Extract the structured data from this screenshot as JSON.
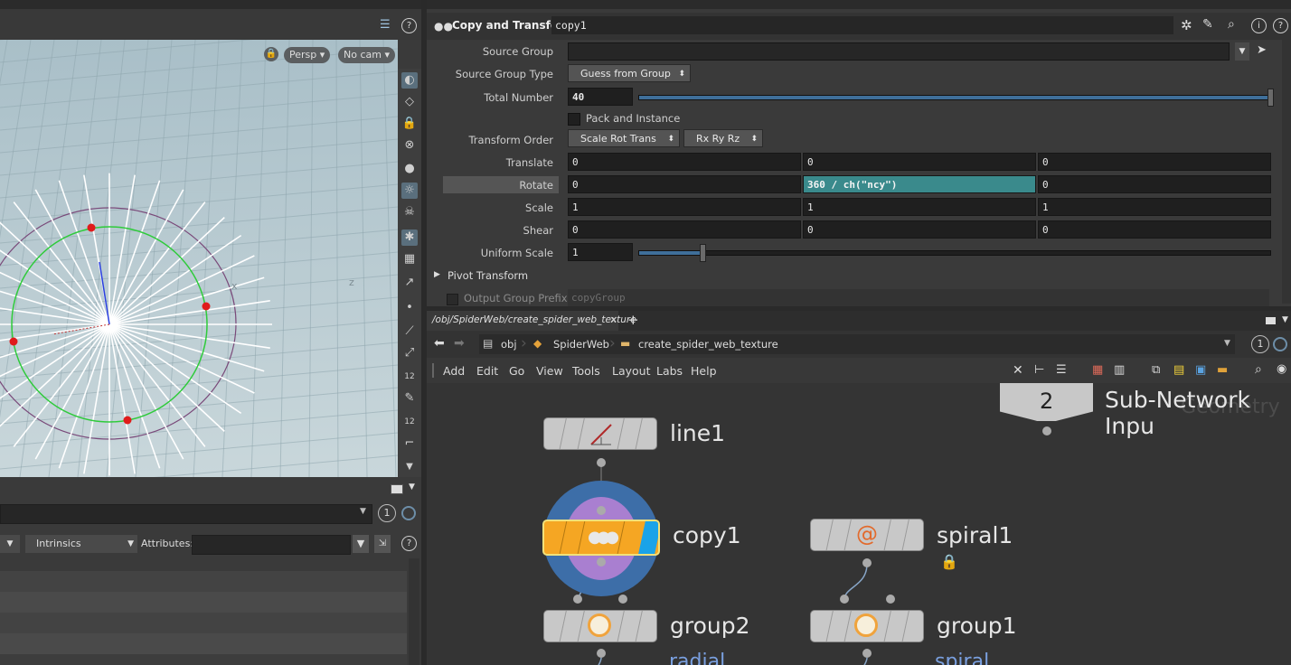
{
  "viewport": {
    "persp_label": "Persp",
    "cam_label": "No cam",
    "axis_x_label": "x",
    "axis_z_label": "z"
  },
  "lower_left": {
    "instance_value": "1",
    "intrinsics_label": "Intrinsics",
    "attributes_label": "Attributes:"
  },
  "params": {
    "node_type": "Copy and Transform",
    "node_name": "copy1",
    "source_group_label": "Source Group",
    "source_group_value": "",
    "source_group_type_label": "Source Group Type",
    "source_group_type_value": "Guess from Group",
    "total_number_label": "Total Number",
    "total_number_value": "40",
    "total_number_fraction": 1.0,
    "pack_label": "Pack and Instance",
    "transform_order_label": "Transform Order",
    "transform_order_value": "Scale Rot Trans",
    "rotate_order_value": "Rx Ry Rz",
    "translate_label": "Translate",
    "translate": [
      "0",
      "0",
      "0"
    ],
    "rotate_label": "Rotate",
    "rotate": [
      "0",
      "360 / ch(\"ncy\")",
      "0"
    ],
    "scale_label": "Scale",
    "scale": [
      "1",
      "1",
      "1"
    ],
    "shear_label": "Shear",
    "shear": [
      "0",
      "0",
      "0"
    ],
    "uniform_scale_label": "Uniform Scale",
    "uniform_scale_value": "1",
    "uniform_scale_fraction": 0.1,
    "pivot_label": "Pivot Transform",
    "output_group_prefix_label": "Output Group Prefix",
    "output_group_prefix_value": "copyGroup"
  },
  "network": {
    "tab_path": "/obj/SpiderWeb/create_spider_web_texture",
    "tab_close": "×",
    "tab_add": "+",
    "breadcrumb": [
      "obj",
      "SpiderWeb",
      "create_spider_web_texture"
    ],
    "instance_value": "1",
    "menu": [
      "Add",
      "Edit",
      "Go",
      "View",
      "Tools",
      "Layout",
      "Labs",
      "Help"
    ],
    "subnet_input_number": "2",
    "subnet_input_label": "Sub-Network Inpu",
    "subnet_input_ghost": "Geometry",
    "nodes": {
      "line1": "line1",
      "copy1": "copy1",
      "spiral1": "spiral1",
      "group2": "group2",
      "group1": "group1"
    },
    "comments": {
      "group2": "radial",
      "group1": "spiral"
    },
    "colors": {
      "selected_node": "#f5a623",
      "display_flag": "#1aa3e8",
      "copy_halo_outer": "#3d6ea8",
      "copy_halo_inner": "#a97fd0"
    }
  }
}
